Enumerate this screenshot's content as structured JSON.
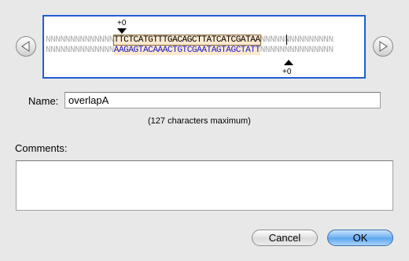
{
  "sequence": {
    "top_prefix": "NNNNNNNNNNNNNN",
    "top_selected": "TTCTCATGTTTGACAGCTTATCATCGATAA",
    "top_suffix": "NNNNNNNNNNNNNNN",
    "bottom_prefix": "NNNNNNNNNNNNNN",
    "bottom_selected": "AAGAGTACAAACTGTCGAATAGTAGCTATT",
    "bottom_suffix": "NNNNNNNNNNNNNNN",
    "top_offset": "+0",
    "bottom_offset": "+0"
  },
  "form": {
    "name_label": "Name:",
    "name_value": "overlapA",
    "name_hint": "(127 characters maximum)",
    "comments_label": "Comments:",
    "comments_value": ""
  },
  "buttons": {
    "cancel": "Cancel",
    "ok": "OK"
  },
  "icons": {
    "prev": "left-triangle-arrow-icon",
    "next": "right-triangle-arrow-icon"
  },
  "colors": {
    "accent": "#1d5fd0",
    "selection": "#fde9cf",
    "bottom_strand": "#1a1ac8",
    "n_bases": "#a8a8a8"
  }
}
